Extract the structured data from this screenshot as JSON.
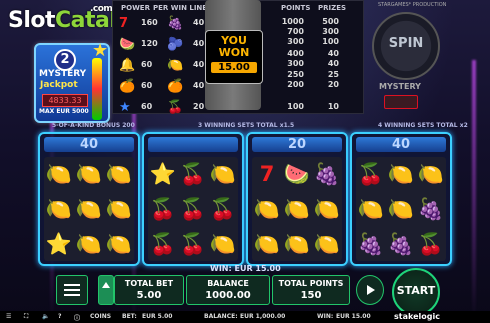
{
  "watermark": {
    "domain": ".com",
    "slot": "Slot",
    "catalog": "Catalog"
  },
  "badge": {
    "number": "2",
    "line1": "MYSTERY",
    "line2": "Jackpot",
    "amount": "4833.33",
    "max": "MAX EUR 5000"
  },
  "paytable": {
    "headers": {
      "power": "POWER",
      "per_win_line": "PER WIN LINE",
      "points": "POINTS",
      "prizes": "PRIZES"
    },
    "rows": [
      {
        "v1": "160",
        "v2": "40"
      },
      {
        "v1": "120",
        "v2": "40"
      },
      {
        "v1": "60",
        "v2": "40"
      },
      {
        "v1": "60",
        "v2": "40"
      },
      {
        "v1": "60",
        "v2": "20"
      }
    ],
    "points": [
      "1000",
      "700",
      "300",
      "400",
      "300",
      "250",
      "200",
      "100"
    ],
    "prizes": [
      "500",
      "300",
      "100",
      "40",
      "40",
      "25",
      "20",
      "10"
    ]
  },
  "youwon": {
    "line1": "YOU",
    "line2": "WON",
    "amount": "15.00"
  },
  "spin": {
    "label": "SPIN",
    "mystery": "MYSTERY",
    "fine_print": "STARGAMES* PRODUCTION"
  },
  "bonus": {
    "left": "5-OF-A-KIND BONUS 200",
    "mid": "3 WINNING SETS TOTAL x1.5",
    "right": "4 WINNING SETS TOTAL x2"
  },
  "panels": [
    {
      "count": "40",
      "cells": [
        "🍋",
        "🍋",
        "🍋",
        "🍋",
        "🍋",
        "🍋",
        "⭐",
        "🍋",
        "🍋"
      ]
    },
    {
      "count": "",
      "cells": [
        "⭐",
        "🍒",
        "🍋",
        "🍒",
        "🍒",
        "🍒",
        "🍒",
        "🍒",
        "🍋"
      ]
    },
    {
      "count": "20",
      "cells": [
        "7",
        "🍉",
        "🍇",
        "🍋",
        "🍋",
        "🍋",
        "🍋",
        "🍋",
        "🍋"
      ]
    },
    {
      "count": "40",
      "cells": [
        "🍒",
        "🍋",
        "🍋",
        "🍋",
        "🍋",
        "🍇",
        "🍇",
        "🍇",
        "🍒"
      ]
    }
  ],
  "controls": {
    "win_line": "WIN: EUR 15.00",
    "total_bet_label": "TOTAL BET",
    "total_bet_value": "5.00",
    "balance_label": "BALANCE",
    "balance_value": "1000.00",
    "total_points_label": "TOTAL POINTS",
    "total_points_value": "150",
    "start": "START"
  },
  "status": {
    "coins": "COINS",
    "bet_label": "BET:",
    "bet_value": "EUR 5.00",
    "balance_label": "BALANCE:",
    "balance_value": "EUR 1,000.00",
    "win_label": "WIN:",
    "win_value": "EUR 15.00",
    "brand": "stakelogic"
  },
  "colors": {
    "accent_blue": "#3cd0ff",
    "accent_green": "#22c46a",
    "win_gold": "#f6a700"
  }
}
